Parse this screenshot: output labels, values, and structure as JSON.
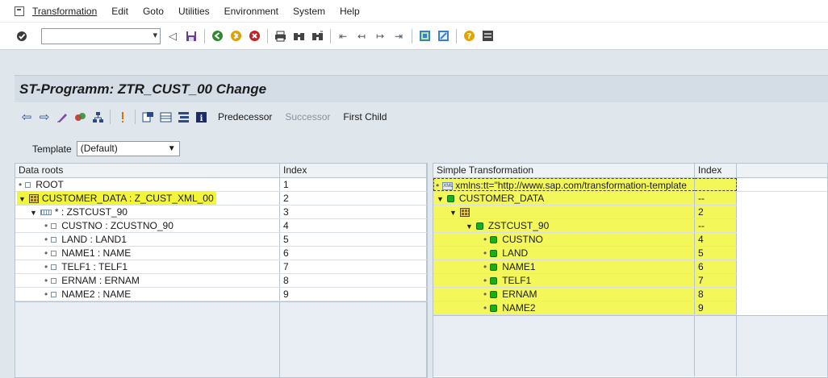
{
  "menubar": {
    "items": [
      "Transformation",
      "Edit",
      "Goto",
      "Utilities",
      "Environment",
      "System",
      "Help"
    ]
  },
  "toolbar": {
    "command_field_value": "",
    "icons": [
      "enter-icon",
      "back-icon",
      "save-icon",
      "back-green-icon",
      "exit-icon",
      "cancel-icon",
      "print-icon",
      "find-icon",
      "find-next-icon",
      "first-page-icon",
      "previous-page-icon",
      "next-page-icon",
      "last-page-icon",
      "create-session-icon",
      "shortcut-icon",
      "help-icon",
      "layout-icon"
    ]
  },
  "title": "ST-Programm: ZTR_CUST_00 Change",
  "app_toolbar": {
    "predecessor": "Predecessor",
    "successor": "Successor",
    "first_child": "First Child"
  },
  "template": {
    "label": "Template",
    "value": "(Default)"
  },
  "data_roots": {
    "headers": [
      "Data roots",
      "Index"
    ],
    "rows": [
      {
        "label": "ROOT",
        "index": "1"
      },
      {
        "label": "CUSTOMER_DATA : Z_CUST_XML_00",
        "index": "2"
      },
      {
        "label": "* : ZSTCUST_90",
        "index": "3"
      },
      {
        "label": "CUSTNO : ZCUSTNO_90",
        "index": "4"
      },
      {
        "label": "LAND : LAND1",
        "index": "5"
      },
      {
        "label": "NAME1 : NAME",
        "index": "6"
      },
      {
        "label": "TELF1 : TELF1",
        "index": "7"
      },
      {
        "label": "ERNAM : ERNAM",
        "index": "8"
      },
      {
        "label": "NAME2 : NAME",
        "index": "9"
      }
    ]
  },
  "simple_transformation": {
    "headers": [
      "Simple Transformation",
      "Index"
    ],
    "rows": [
      {
        "label": "xmlns:tt=\"http://www.sap.com/transformation-template",
        "index": ""
      },
      {
        "label": "CUSTOMER_DATA",
        "index": "--"
      },
      {
        "label": "",
        "index": "2"
      },
      {
        "label": "ZSTCUST_90",
        "index": "--"
      },
      {
        "label": "CUSTNO",
        "index": "4"
      },
      {
        "label": "LAND",
        "index": "5"
      },
      {
        "label": "NAME1",
        "index": "6"
      },
      {
        "label": "TELF1",
        "index": "7"
      },
      {
        "label": "ERNAM",
        "index": "8"
      },
      {
        "label": "NAME2",
        "index": "9"
      }
    ]
  },
  "colors": {
    "highlight": "#f2f53a",
    "node_green": "#18b018",
    "title_bg": "#d4dde6"
  }
}
